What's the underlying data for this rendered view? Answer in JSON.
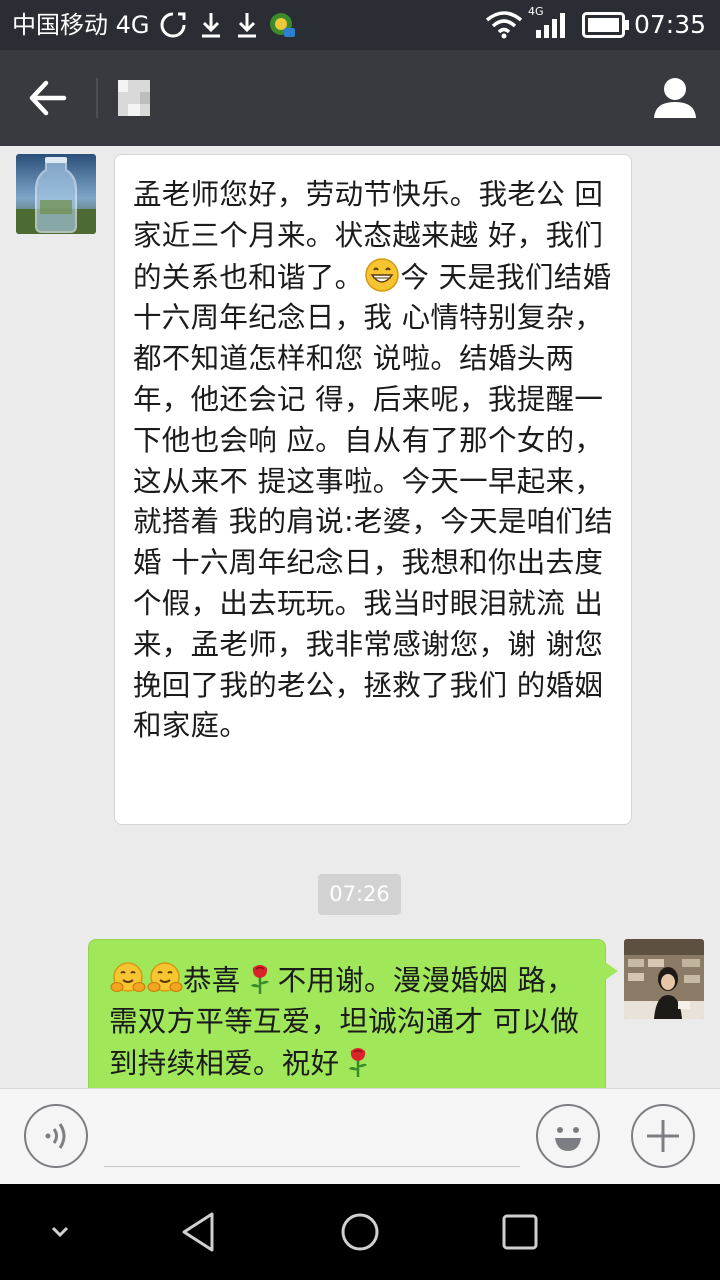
{
  "status_bar": {
    "carrier": "中国移动 4G",
    "network_badge": "4G",
    "time": "07:35",
    "icons": [
      "sync-icon",
      "download-icon",
      "download-icon",
      "app-notification-icon",
      "wifi-icon",
      "signal-icon",
      "battery-icon"
    ]
  },
  "title_bar": {
    "back_icon": "arrow-left-icon",
    "title_icon": "pixelated-contact-name",
    "profile_icon": "person-icon"
  },
  "messages": [
    {
      "direction": "incoming",
      "lines": [
        "孟老师您好，劳动节快乐。我老公",
        "回家近三个月来。状态越来越",
        "好，我们的关系也和谐了。",
        "今",
        "天是我们结婚十六周年纪念日，我",
        "心情特别复杂，都不知道怎样和您",
        "说啦。结婚头两年，他还会记",
        "得，后来呢，我提醒一下他也会响",
        "应。自从有了那个女的，这从来不",
        "提这事啦。今天一早起来，就搭着",
        "我的肩说:老婆，今天是咱们结婚",
        "十六周年纪念日，我想和你出去度",
        "个假，出去玩玩。我当时眼泪就流",
        "出来，孟老师，我非常感谢您，谢",
        "谢您挽回了我的老公，拯救了我们",
        "的婚姻和家庭。"
      ],
      "emoji": "grinning-face-icon"
    },
    {
      "direction": "outgoing",
      "timestamp": "07:26",
      "lines": [
        "恭喜",
        "不用谢。漫漫婚姻",
        "路，需双方平等互爱，坦诚沟通才",
        "可以做到持续相爱。祝好"
      ],
      "emojis": [
        "hugging-face-icon",
        "hugging-face-icon",
        "rose-icon",
        "rose-icon"
      ]
    }
  ],
  "input_bar": {
    "placeholder": "",
    "icons": [
      "voice-icon",
      "emoji-icon",
      "plus-icon"
    ]
  },
  "nav_bar": {
    "icons": [
      "collapse-icon",
      "back-triangle-icon",
      "home-circle-icon",
      "recents-square-icon"
    ]
  },
  "colors": {
    "title_bar": "#393a3f",
    "status_bar": "#2a2d33",
    "chat_background": "#ebebeb",
    "outgoing_bubble": "#a0e75a",
    "incoming_bubble": "#ffffff"
  }
}
